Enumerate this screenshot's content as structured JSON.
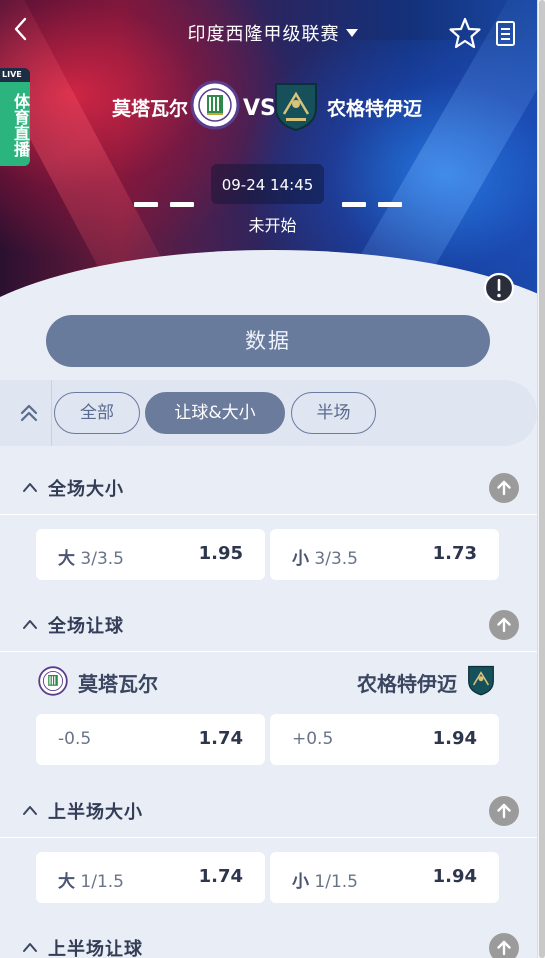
{
  "header": {
    "league_title": "印度西隆甲级联赛",
    "back_icon": "chevron-left-icon",
    "favorite_icon": "star-outline-icon",
    "doc_icon": "document-icon"
  },
  "live_badge": {
    "top": "LIVE",
    "label": "体育直播"
  },
  "match": {
    "home_team": "莫塔瓦尔",
    "away_team": "农格特伊迈",
    "vs": "VS",
    "datetime": "09-24 14:45",
    "status": "未开始",
    "info_icon": "exclamation-circle-icon"
  },
  "data_button": "数据",
  "tabs": [
    {
      "label": "全部",
      "active": false
    },
    {
      "label": "让球&大小",
      "active": true
    },
    {
      "label": "半场",
      "active": false
    }
  ],
  "markets": [
    {
      "title": "全场大小",
      "odds": [
        {
          "prefix": "大",
          "line": "3/3.5",
          "value": "1.95"
        },
        {
          "prefix": "小",
          "line": "3/3.5",
          "value": "1.73"
        }
      ]
    },
    {
      "title": "全场让球",
      "home_team": "莫塔瓦尔",
      "away_team": "农格特伊迈",
      "odds": [
        {
          "prefix": "",
          "line": "-0.5",
          "value": "1.74"
        },
        {
          "prefix": "",
          "line": "+0.5",
          "value": "1.94"
        }
      ]
    },
    {
      "title": "上半场大小",
      "odds": [
        {
          "prefix": "大",
          "line": "1/1.5",
          "value": "1.74"
        },
        {
          "prefix": "小",
          "line": "1/1.5",
          "value": "1.94"
        }
      ]
    },
    {
      "title": "上半场让球"
    }
  ],
  "colors": {
    "page_bg": "#e9edf6",
    "accent": "#6b7b9c",
    "live_green": "#2bb47e"
  }
}
